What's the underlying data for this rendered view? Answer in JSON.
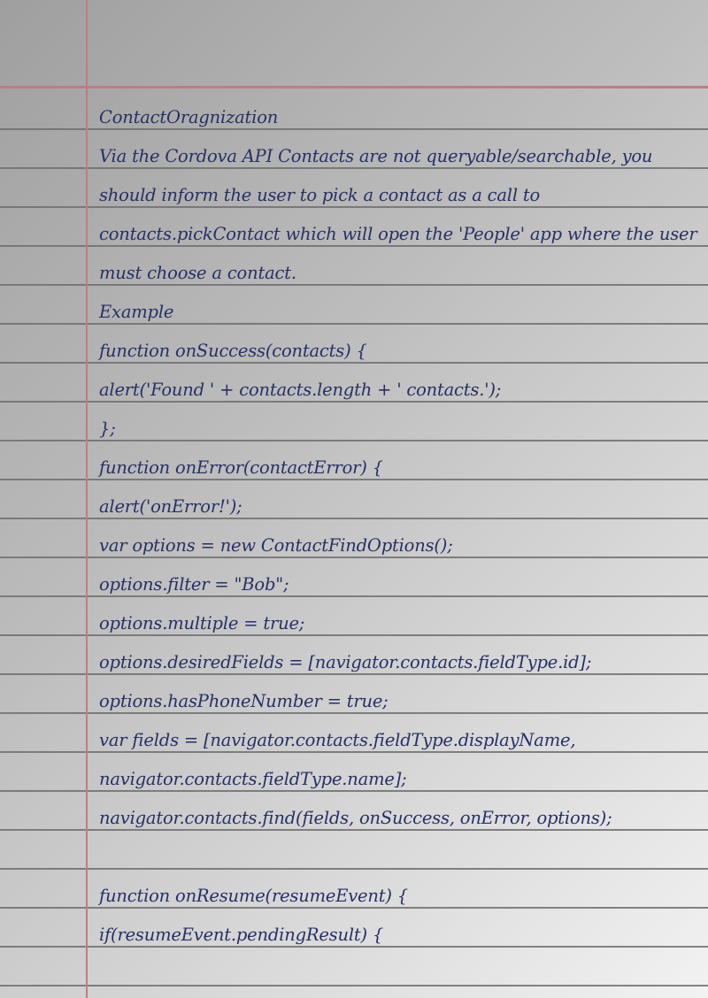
{
  "document": {
    "lines": [
      "ContactOragnization",
      " Via the Cordova API Contacts are not queryable/searchable, you",
      "should inform the user to pick a contact as a call to",
      "contacts.pickContact which will open the 'People' app where the user",
      "must choose a contact.",
      "Example",
      "function onSuccess(contacts) {",
      "alert('Found ' + contacts.length + ' contacts.');",
      "};",
      "function onError(contactError) {",
      "alert('onError!');",
      "var options = new ContactFindOptions();",
      "options.filter = \"Bob\";",
      "options.multiple = true;",
      "options.desiredFields = [navigator.contacts.fieldType.id];",
      "options.hasPhoneNumber = true;",
      "var fields = [navigator.contacts.fieldType.displayName,",
      "navigator.contacts.fieldType.name];",
      "navigator.contacts.find(fields, onSuccess, onError, options);",
      "",
      "function onResume(resumeEvent) {",
      "if(resumeEvent.pendingResult) {"
    ]
  }
}
